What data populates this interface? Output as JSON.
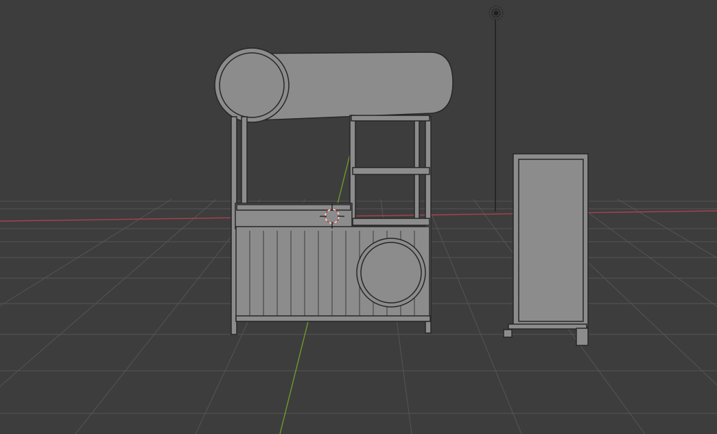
{
  "viewport": {
    "background_color": "#3d3d3d",
    "grid_line_color": "#555555",
    "x_axis_color": "#a8434f",
    "y_axis_color": "#6f9a2c"
  },
  "scene": {
    "object_color": "#8c8c8c",
    "object_outline_color": "#262626",
    "objects": [
      "market-stall",
      "banner-stand"
    ],
    "light_icon": "light-icon",
    "cursor_icon": "3d-cursor-icon"
  }
}
